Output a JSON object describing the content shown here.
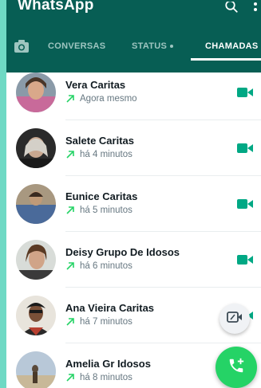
{
  "app": {
    "title": "WhatsApp"
  },
  "tabs": [
    {
      "label": "CONVERSAS",
      "active": false
    },
    {
      "label": "STATUS",
      "active": false,
      "dot": true
    },
    {
      "label": "CHAMADAS",
      "active": true
    }
  ],
  "calls": [
    {
      "name": "Vera Caritas",
      "time": "Agora mesmo",
      "direction": "outgoing",
      "type": "video"
    },
    {
      "name": "Salete Caritas",
      "time": "há 4 minutos",
      "direction": "outgoing",
      "type": "video"
    },
    {
      "name": "Eunice Caritas",
      "time": "há 5 minutos",
      "direction": "outgoing",
      "type": "video"
    },
    {
      "name": "Deisy Grupo De Idosos",
      "time": "há 6 minutos",
      "direction": "outgoing",
      "type": "video"
    },
    {
      "name": "Ana Vieira Caritas",
      "time": "há 7 minutos",
      "direction": "outgoing",
      "type": "video"
    },
    {
      "name": "Amelia Gr Idosos",
      "time": "há 8 minutos",
      "direction": "outgoing",
      "type": "video"
    }
  ],
  "colors": {
    "header": "#075e54",
    "accent": "#25d366",
    "video_icon": "#00a884",
    "outgoing_arrow": "#25d366"
  },
  "icons": {
    "search": "search-icon",
    "menu": "more-vert-icon",
    "camera": "camera-icon",
    "video": "videocam-icon",
    "outgoing": "call-made-icon",
    "link": "call-link-icon",
    "new_call": "add-call-icon"
  }
}
